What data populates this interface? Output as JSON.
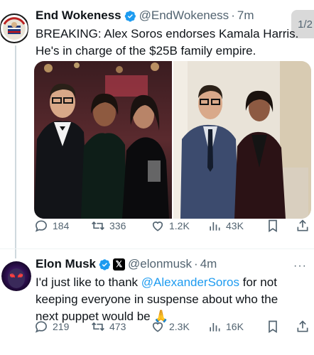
{
  "tweet1": {
    "display_name": "End Wokeness",
    "handle": "@EndWokeness",
    "time": "7m",
    "text_line1": "BREAKING: Alex Soros endorses Kamala Harris.",
    "text_line2": "He's in charge of the $25B family empire.",
    "pager": "1/2",
    "stats": {
      "replies": "184",
      "reposts": "336",
      "likes": "1.2K",
      "views": "43K"
    }
  },
  "tweet2": {
    "display_name": "Elon Musk",
    "handle": "@elonmusk",
    "time": "4m",
    "text_line1": "I'd just like to thank ",
    "mention": "@AlexanderSoros",
    "text_line1_end": " for not",
    "text_line2": "keeping everyone in suspense about who the",
    "text_line3": "next puppet would be ",
    "emoji": "🙏",
    "more": "···",
    "stats": {
      "replies": "219",
      "reposts": "473",
      "likes": "2.3K",
      "views": "16K"
    }
  },
  "dot": "·",
  "x_badge": "𝕏",
  "colors": {
    "verified": "#1d9bf0",
    "secondary_text": "#536471",
    "link": "#1d9bf0"
  },
  "icons": [
    "reply-icon",
    "repost-icon",
    "like-icon",
    "views-icon",
    "bookmark-icon",
    "share-icon",
    "verified-badge-icon",
    "x-affiliate-badge-icon"
  ]
}
